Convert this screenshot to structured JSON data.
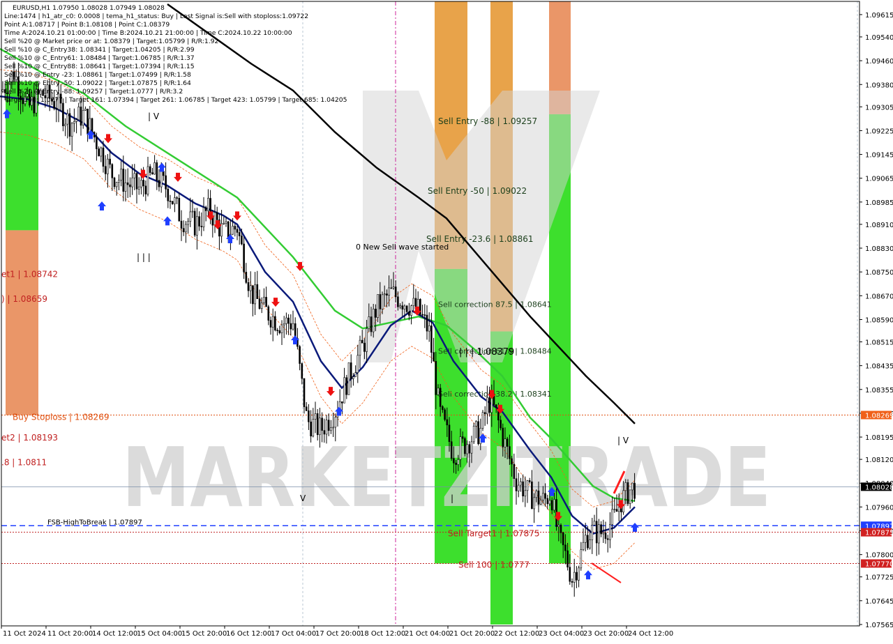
{
  "header": {
    "lines": [
      "EURUSD,H1  1.07950 1.08028 1.07949 1.08028",
      "Line:1474 | h1_atr_c0: 0.0008 | tema_h1_status: Buy | Last Signal is:Sell with stoploss:1.09722",
      "Point A:1.08717 | Point B:1.08108 | Point C:1.08379",
      "Time A:2024.10.21 01:00:00 | Time B:2024.10.21 21:00:00 | Time C:2024.10.22 10:00:00",
      "Sell %20 @ Market price or at: 1.08379 | Target:1.05799 | R/R:1.92",
      "Sell %10 @ C_Entry38: 1.08341 | Target:1.04205 | R/R:2.99",
      "Sell %10 @ C_Entry61: 1.08484 | Target:1.06785 | R/R:1.37",
      "Sell %10 @ C_Entry88: 1.08641 | Target:1.07394 | R/R:1.15",
      "Sell %10 @ Entry -23: 1.08861 | Target:1.07499 | R/R:1.58",
      "Sell %10 @ Entry -50: 1.09022 | Target:1.07875 | R/R:1.64",
      "Sell %20 @ Entry -88: 1.09257 | Target:1.0777 | R/R:3.2",
      "Target100: 1.0777 | Target 161: 1.07394 | Target 261: 1.06785 | Target 423: 1.05799 | Target 685: 1.04205"
    ]
  },
  "watermark": "MARKETZITRADE",
  "price_axis": {
    "ticks": [
      "1.09615",
      "1.09540",
      "1.09460",
      "1.09380",
      "1.09305",
      "1.09225",
      "1.09145",
      "1.09065",
      "1.08985",
      "1.08910",
      "1.08830",
      "1.08750",
      "1.08670",
      "1.08590",
      "1.08515",
      "1.08435",
      "1.08355",
      "1.08275",
      "1.08195",
      "1.08120",
      "1.08040",
      "1.07960",
      "1.07880",
      "1.07800",
      "1.07725",
      "1.07645",
      "1.07565"
    ],
    "current_price": "1.08028",
    "tags": [
      {
        "label": "1.08269",
        "price": 1.08269,
        "bg": "#f06018"
      },
      {
        "label": "1.08028",
        "price": 1.08028,
        "bg": "#000000"
      },
      {
        "label": "1.07897",
        "price": 1.07897,
        "bg": "#1f3fff"
      },
      {
        "label": "1.07875",
        "price": 1.07875,
        "bg": "#d02020"
      },
      {
        "label": "1.07770",
        "price": 1.0777,
        "bg": "#d02020"
      }
    ]
  },
  "time_axis": {
    "labels": [
      "11 Oct 2024",
      "11 Oct 20:00",
      "14 Oct 12:00",
      "15 Oct 04:00",
      "15 Oct 20:00",
      "16 Oct 12:00",
      "17 Oct 04:00",
      "17 Oct 20:00",
      "18 Oct 12:00",
      "21 Oct 04:00",
      "21 Oct 20:00",
      "22 Oct 12:00",
      "23 Oct 04:00",
      "23 Oct 20:00",
      "24 Oct 12:00"
    ]
  },
  "levels": [
    {
      "label": "Buy Stoploss | 1.08269",
      "price": 1.08269,
      "color": "#e05010",
      "style": "dotted"
    },
    {
      "label": "FSB-HighToBreak | 1.07897",
      "price": 1.07897,
      "color": "#1f3fff",
      "style": "dashed"
    },
    {
      "label": "Sell Target1 | 1.07875",
      "price": 1.07875,
      "color": "#c02020",
      "style": "dotted"
    },
    {
      "label": "Sell 100 | 1.0777",
      "price": 1.0777,
      "color": "#c02020",
      "style": "dotted"
    }
  ],
  "left_labels": [
    {
      "text": "et1 | 1.08742",
      "price": 1.08742,
      "color": "#c02020"
    },
    {
      "text": ") | 1.08659",
      "price": 1.08659,
      "color": "#c02020"
    },
    {
      "text": "et2 | 1.08193",
      "price": 1.08193,
      "color": "#c02020"
    },
    {
      "text": ".8 | 1.0811",
      "price": 1.0811,
      "color": "#c02020"
    }
  ],
  "zone_labels": [
    {
      "text": "Sell Entry -88 | 1.09257",
      "price": 1.09257
    },
    {
      "text": "Sell Entry -50 | 1.09022",
      "price": 1.09022
    },
    {
      "text": "Sell Entry -23.6 | 1.08861",
      "price": 1.08861
    },
    {
      "text": "Sell correction 87.5 | 1.08641",
      "price": 1.08641
    },
    {
      "text": "Sell correction 61.8 | 1.08484",
      "price": 1.08484
    },
    {
      "text": "Sell correction 38.2 | 1.08341",
      "price": 1.08341
    }
  ],
  "annotations": {
    "wave": "0 New Sell wave started",
    "pattern": "| | | 1.08379",
    "marks": [
      "| V",
      "| | |",
      "V",
      "|",
      "| V"
    ]
  },
  "colors": {
    "green": "#33dd22",
    "orange": "#e79e40",
    "salmon": "#e99060",
    "ema_green": "#33cc33",
    "ema_navy": "#0a1a7a",
    "ma_black": "#000000",
    "axis": "#000000"
  },
  "chart_data": {
    "type": "candlestick",
    "symbol": "EURUSD",
    "timeframe": "H1",
    "ylim": [
      1.07565,
      1.0965
    ],
    "close_path": [
      [
        0,
        1.0935
      ],
      [
        20,
        1.0942
      ],
      [
        40,
        1.093
      ],
      [
        60,
        1.0935
      ],
      [
        80,
        1.0932
      ],
      [
        100,
        1.0925
      ],
      [
        120,
        1.0928
      ],
      [
        140,
        1.0918
      ],
      [
        160,
        1.0908
      ],
      [
        180,
        1.0905
      ],
      [
        200,
        1.0903
      ],
      [
        220,
        1.0908
      ],
      [
        240,
        1.0903
      ],
      [
        260,
        1.0893
      ],
      [
        280,
        1.0891
      ],
      [
        300,
        1.0896
      ],
      [
        320,
        1.0888
      ],
      [
        340,
        1.089
      ],
      [
        360,
        1.0868
      ],
      [
        380,
        1.0862
      ],
      [
        400,
        1.0858
      ],
      [
        420,
        1.0858
      ],
      [
        440,
        1.0825
      ],
      [
        460,
        1.0822
      ],
      [
        480,
        1.0828
      ],
      [
        500,
        1.084
      ],
      [
        520,
        1.085
      ],
      [
        540,
        1.0863
      ],
      [
        560,
        1.0868
      ],
      [
        580,
        1.0865
      ],
      [
        600,
        1.0862
      ],
      [
        615,
        1.0855
      ],
      [
        630,
        1.0828
      ],
      [
        650,
        1.0814
      ],
      [
        670,
        1.0818
      ],
      [
        690,
        1.0822
      ],
      [
        700,
        1.0832
      ],
      [
        710,
        1.0828
      ],
      [
        720,
        1.082
      ],
      [
        740,
        1.0805
      ],
      [
        760,
        1.08
      ],
      [
        780,
        1.0798
      ],
      [
        790,
        1.0801
      ],
      [
        800,
        1.0786
      ],
      [
        810,
        1.078
      ],
      [
        820,
        1.0772
      ],
      [
        830,
        1.0778
      ],
      [
        840,
        1.0786
      ],
      [
        850,
        1.0788
      ],
      [
        860,
        1.0787
      ],
      [
        870,
        1.0789
      ],
      [
        880,
        1.0792
      ],
      [
        890,
        1.0798
      ],
      [
        900,
        1.0801
      ],
      [
        910,
        1.0803
      ]
    ],
    "ema_fast": [
      [
        0,
        1.0934
      ],
      [
        40,
        1.0933
      ],
      [
        80,
        1.093
      ],
      [
        120,
        1.0925
      ],
      [
        160,
        1.0915
      ],
      [
        200,
        1.0908
      ],
      [
        240,
        1.0904
      ],
      [
        280,
        1.0898
      ],
      [
        320,
        1.0894
      ],
      [
        340,
        1.0891
      ],
      [
        380,
        1.0875
      ],
      [
        420,
        1.0865
      ],
      [
        460,
        1.0845
      ],
      [
        490,
        1.0836
      ],
      [
        520,
        1.0843
      ],
      [
        560,
        1.0857
      ],
      [
        590,
        1.0862
      ],
      [
        620,
        1.0858
      ],
      [
        650,
        1.0845
      ],
      [
        690,
        1.0833
      ],
      [
        720,
        1.0828
      ],
      [
        760,
        1.0815
      ],
      [
        790,
        1.0806
      ],
      [
        820,
        1.0793
      ],
      [
        850,
        1.0787
      ],
      [
        880,
        1.0789
      ],
      [
        910,
        1.0796
      ]
    ],
    "ema_slow": [
      [
        0,
        1.095
      ],
      [
        60,
        1.0942
      ],
      [
        120,
        1.0935
      ],
      [
        180,
        1.0924
      ],
      [
        240,
        1.0915
      ],
      [
        300,
        1.0906
      ],
      [
        340,
        1.09
      ],
      [
        380,
        1.089
      ],
      [
        420,
        1.088
      ],
      [
        480,
        1.0862
      ],
      [
        520,
        1.0856
      ],
      [
        560,
        1.0858
      ],
      [
        600,
        1.086
      ],
      [
        640,
        1.0857
      ],
      [
        680,
        1.0849
      ],
      [
        720,
        1.084
      ],
      [
        760,
        1.0826
      ],
      [
        790,
        1.0819
      ],
      [
        820,
        1.0811
      ],
      [
        850,
        1.0803
      ],
      [
        880,
        1.0799
      ],
      [
        910,
        1.0798
      ]
    ],
    "ma_long": [
      [
        240,
        1.0965
      ],
      [
        300,
        1.0955
      ],
      [
        360,
        1.0945
      ],
      [
        420,
        1.0936
      ],
      [
        480,
        1.0922
      ],
      [
        540,
        1.091
      ],
      [
        600,
        1.09
      ],
      [
        640,
        1.0893
      ],
      [
        680,
        1.0882
      ],
      [
        720,
        1.0871
      ],
      [
        760,
        1.086
      ],
      [
        800,
        1.085
      ],
      [
        840,
        1.084
      ],
      [
        880,
        1.0831
      ],
      [
        910,
        1.0824
      ]
    ],
    "zones": [
      {
        "name": "left-green",
        "x": [
          8,
          55
        ],
        "from": 1.0939,
        "to": 1.0889,
        "color": "green"
      },
      {
        "name": "left-salmon",
        "x": [
          8,
          55
        ],
        "from": 1.0889,
        "to": 1.08269,
        "color": "salmon"
      },
      {
        "name": "zone-1-orange",
        "x": [
          623,
          670
        ],
        "from": 1.0966,
        "to": 1.0876,
        "color": "orange"
      },
      {
        "name": "zone-1-green",
        "x": [
          623,
          670
        ],
        "from": 1.0876,
        "to": 1.0777,
        "color": "green"
      },
      {
        "name": "zone-2-orange",
        "x": [
          703,
          735
        ],
        "from": 1.0966,
        "to": 1.0855,
        "color": "orange"
      },
      {
        "name": "zone-2-green",
        "x": [
          703,
          735
        ],
        "from": 1.0855,
        "to": 1.07565,
        "color": "green"
      },
      {
        "name": "zone-3-orange",
        "x": [
          787,
          818
        ],
        "from": 1.0966,
        "to": 1.0928,
        "color": "salmon"
      },
      {
        "name": "zone-3-green",
        "x": [
          787,
          818
        ],
        "from": 1.0928,
        "to": 1.0777,
        "color": "green"
      }
    ],
    "sell_arrows": [
      [
        155,
        1.0919
      ],
      [
        205,
        1.0907
      ],
      [
        255,
        1.0906
      ],
      [
        302,
        1.0893
      ],
      [
        312,
        1.089
      ],
      [
        340,
        1.0893
      ],
      [
        395,
        1.0864
      ],
      [
        430,
        1.0876
      ],
      [
        474,
        1.0834
      ],
      [
        598,
        1.0861
      ],
      [
        705,
        1.0833
      ],
      [
        717,
        1.0828
      ],
      [
        800,
        1.0792
      ],
      [
        890,
        1.0796
      ]
    ],
    "buy_arrows": [
      [
        10,
        1.0929
      ],
      [
        130,
        1.0922
      ],
      [
        146,
        1.0898
      ],
      [
        232,
        1.0911
      ],
      [
        240,
        1.0893
      ],
      [
        330,
        1.0887
      ],
      [
        423,
        1.0853
      ],
      [
        486,
        1.0829
      ],
      [
        692,
        1.082
      ],
      [
        791,
        1.0802
      ],
      [
        843,
        1.0774
      ],
      [
        910,
        1.079
      ]
    ]
  }
}
